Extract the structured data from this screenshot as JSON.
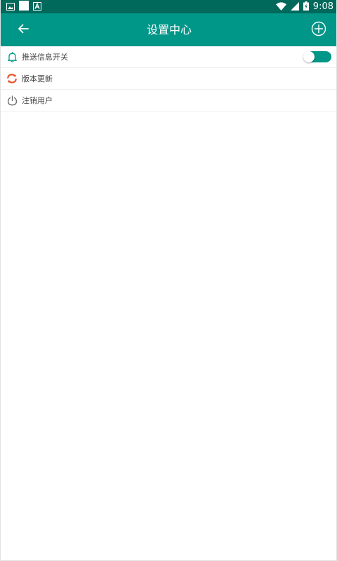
{
  "status_bar": {
    "time": "9:08",
    "left_icons": [
      "image-icon",
      "white-square-icon",
      "a-notification-icon"
    ],
    "right_icons": [
      "wifi-icon",
      "signal-icon",
      "battery-charging-icon"
    ]
  },
  "app_bar": {
    "title": "设置中心",
    "back_icon": "arrow-left-icon",
    "add_icon": "plus-circle-icon",
    "color": "#009688",
    "status_color": "#00695c"
  },
  "settings": {
    "items": [
      {
        "label": "推送信息开关",
        "icon": "bell-icon",
        "icon_color": "#009688",
        "toggle_on": true
      },
      {
        "label": "版本更新",
        "icon": "refresh-icon",
        "icon_color": "#e64a19"
      },
      {
        "label": "注销用户",
        "icon": "power-icon",
        "icon_color": "#666666"
      }
    ]
  }
}
